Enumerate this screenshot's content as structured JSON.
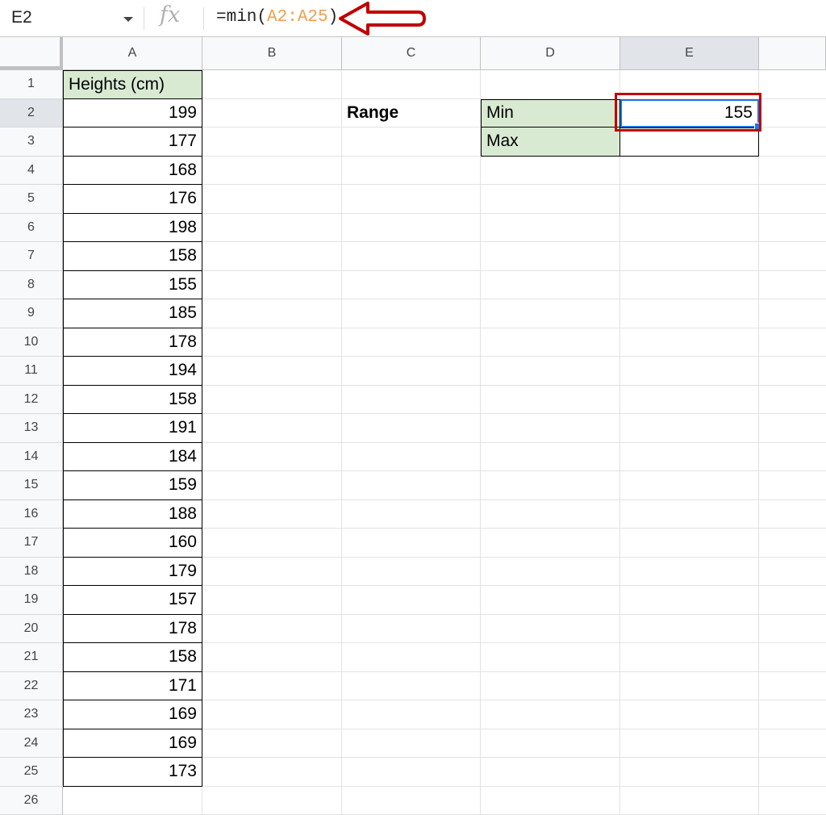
{
  "formula_bar": {
    "name_box": "E2",
    "fx_label": "fx",
    "formula_prefix": "=min(",
    "formula_ref": "A2:A25",
    "formula_suffix": ")"
  },
  "columns": [
    "A",
    "B",
    "C",
    "D",
    "E"
  ],
  "rows": [
    "1",
    "2",
    "3",
    "4",
    "5",
    "6",
    "7",
    "8",
    "9",
    "10",
    "11",
    "12",
    "13",
    "14",
    "15",
    "16",
    "17",
    "18",
    "19",
    "20",
    "21",
    "22",
    "23",
    "24",
    "25",
    "26"
  ],
  "sheet": {
    "A1": "Heights (cm)",
    "heights": [
      "199",
      "177",
      "168",
      "176",
      "198",
      "158",
      "155",
      "185",
      "178",
      "194",
      "158",
      "191",
      "184",
      "159",
      "188",
      "160",
      "179",
      "157",
      "178",
      "158",
      "171",
      "169",
      "169",
      "173"
    ],
    "C2": "Range",
    "D2": "Min",
    "D3": "Max",
    "E2": "155",
    "E3": ""
  },
  "colors": {
    "header_green": "#d9ead3",
    "selection_blue": "#1a73e8",
    "annotation_red": "#c00000",
    "formula_ref": "#f39c4a"
  }
}
